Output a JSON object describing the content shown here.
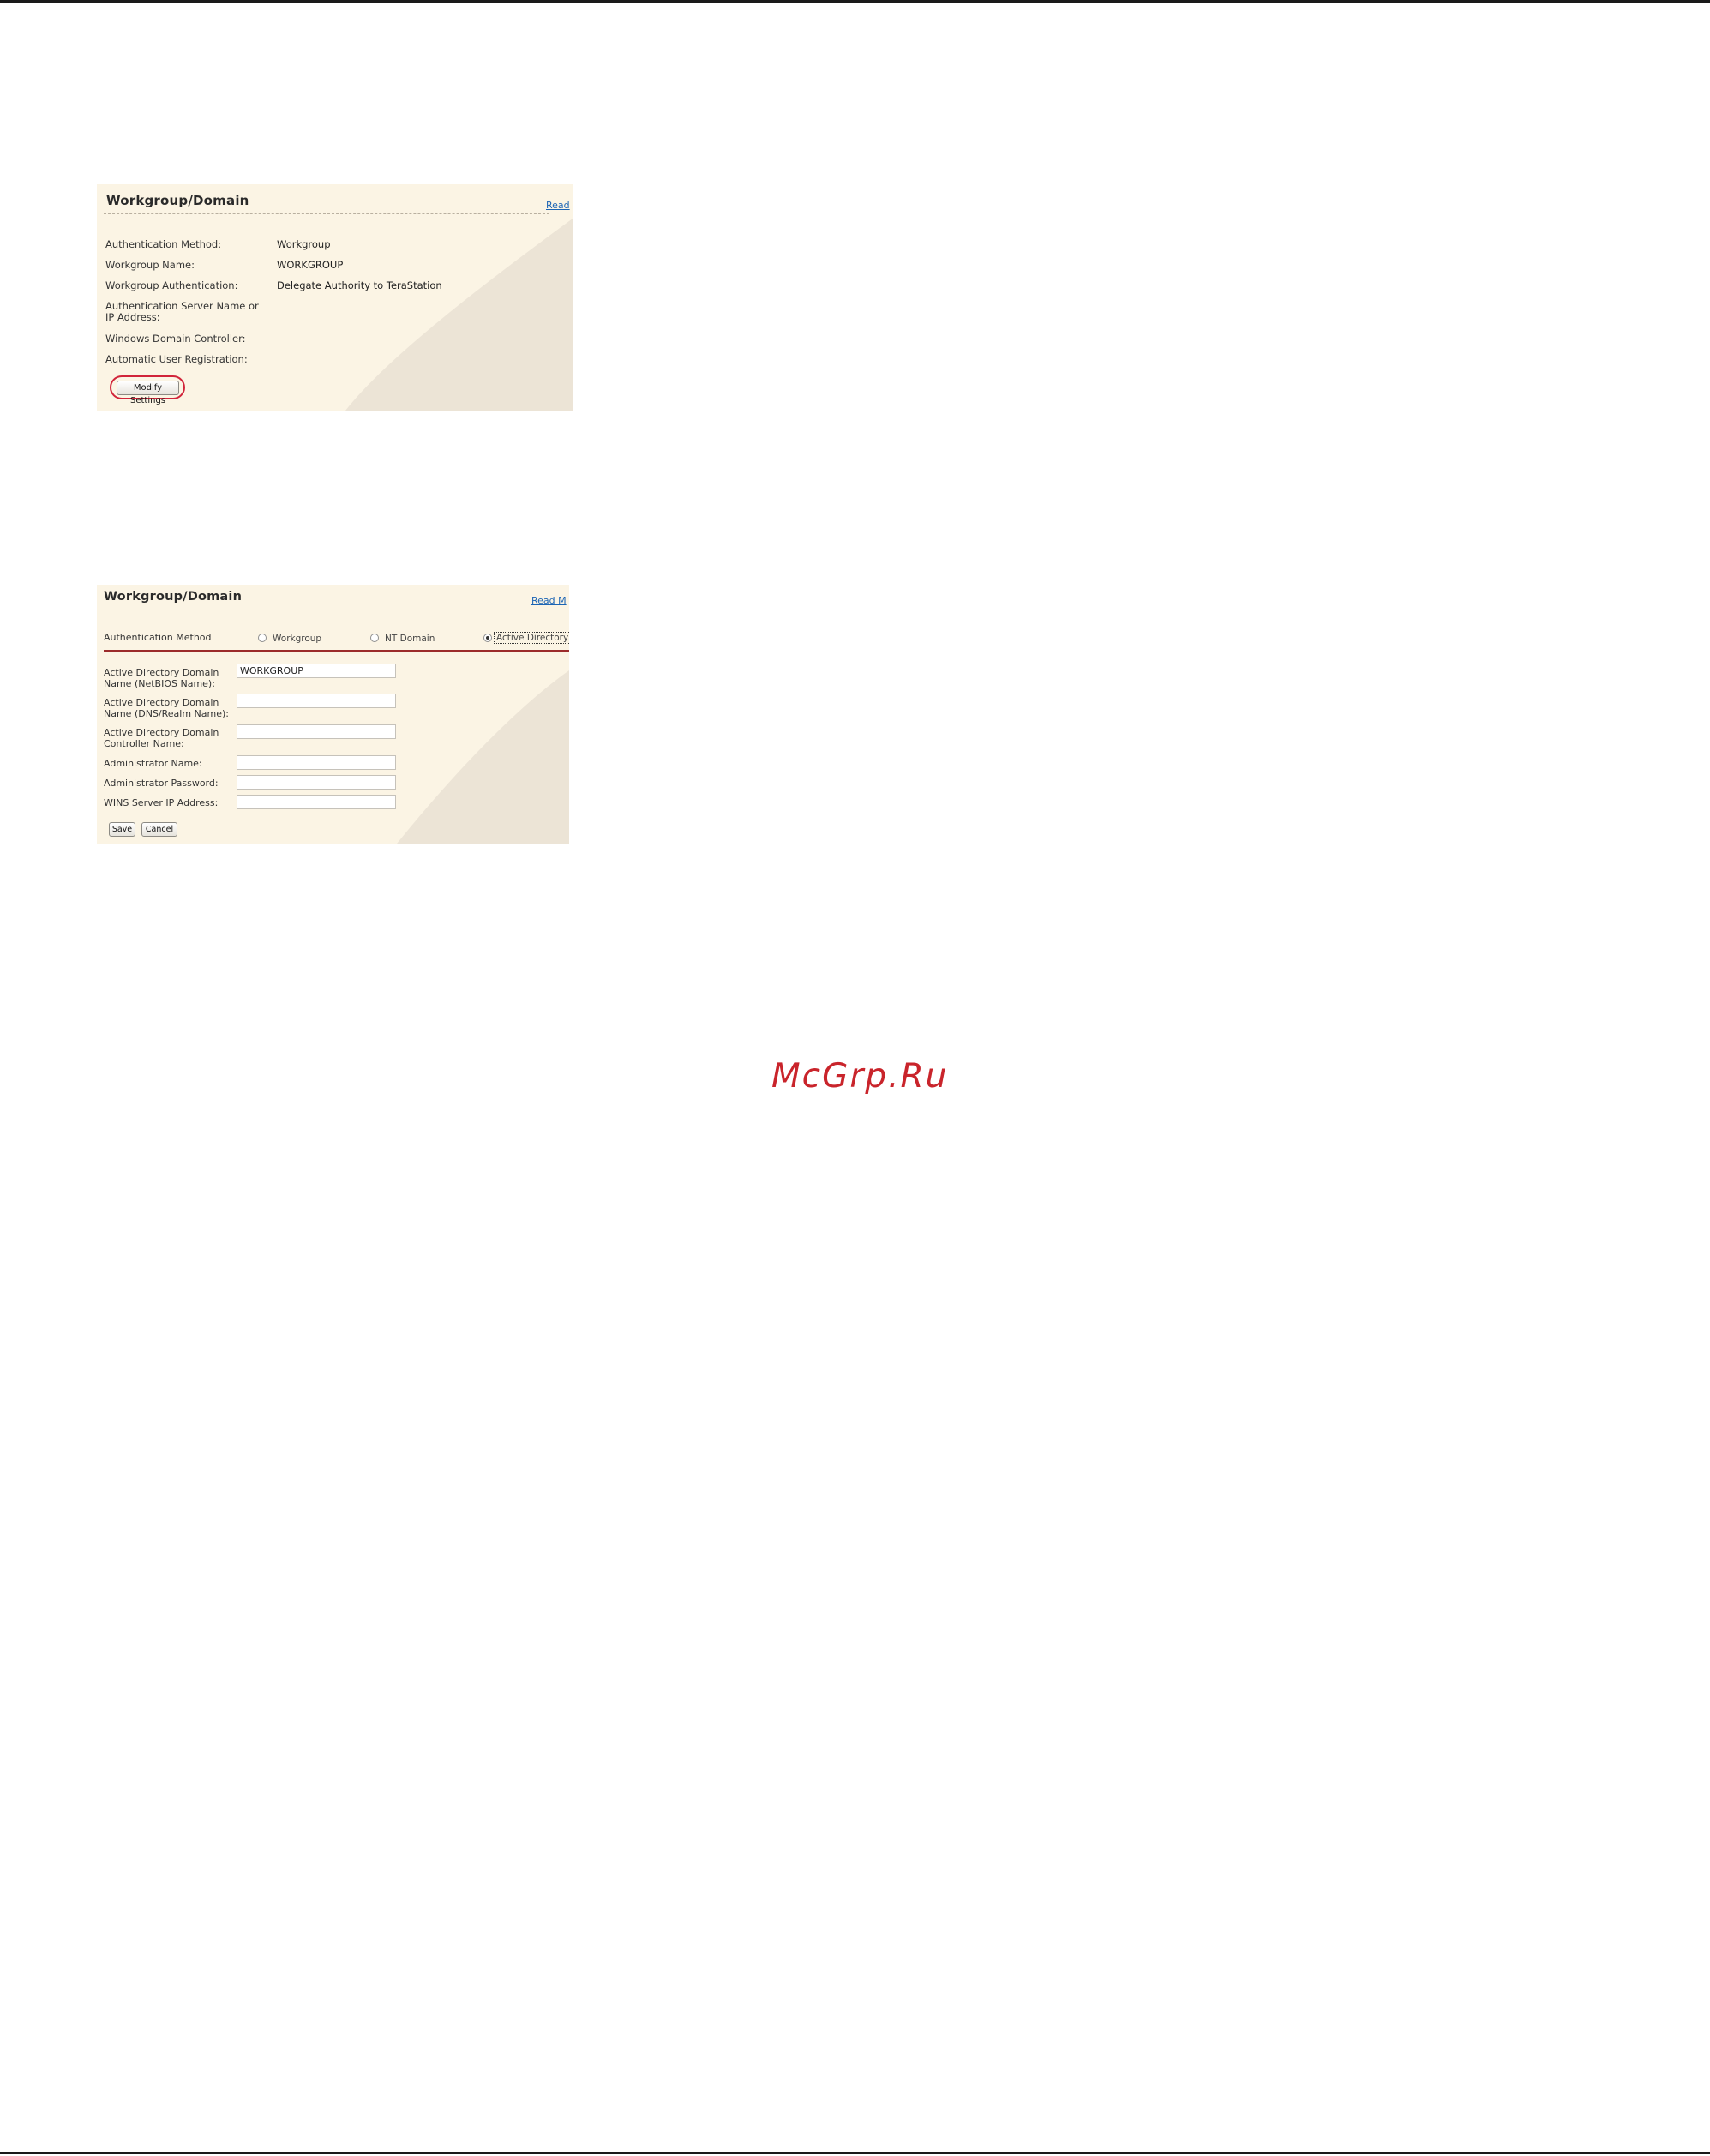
{
  "panel1": {
    "title": "Workgroup/Domain",
    "read_more": "Read",
    "rows": [
      {
        "label": "Authentication Method:",
        "value": "Workgroup"
      },
      {
        "label": "Workgroup Name:",
        "value": "WORKGROUP"
      },
      {
        "label": "Workgroup Authentication:",
        "value": "Delegate Authority to TeraStation"
      },
      {
        "label": "Authentication Server Name or IP Address:",
        "value": ""
      },
      {
        "label": "Windows Domain Controller:",
        "value": ""
      },
      {
        "label": "Automatic User Registration:",
        "value": ""
      }
    ],
    "modify_button": "Modify Settings"
  },
  "panel2": {
    "title": "Workgroup/Domain",
    "read_more": "Read M",
    "auth_method_label": "Authentication Method",
    "radios": [
      {
        "label": "Workgroup",
        "selected": false
      },
      {
        "label": "NT Domain",
        "selected": false
      },
      {
        "label": "Active Directory",
        "selected": true
      }
    ],
    "fields": [
      {
        "label": "Active Directory Domain Name (NetBIOS Name):",
        "value": "WORKGROUP"
      },
      {
        "label": "Active Directory Domain Name (DNS/Realm Name):",
        "value": ""
      },
      {
        "label": "Active Directory Domain Controller Name:",
        "value": ""
      },
      {
        "label": "Administrator Name:",
        "value": ""
      },
      {
        "label": "Administrator Password:",
        "value": ""
      },
      {
        "label": "WINS Server IP Address:",
        "value": ""
      }
    ],
    "save_button": "Save",
    "cancel_button": "Cancel"
  },
  "watermark": "McGrp.Ru",
  "colors": {
    "panel_bg": "#fbf4e4",
    "swoosh": "#ece4d6",
    "link": "#1b64b4",
    "highlight_ring": "#d1243a",
    "section_rule": "#9c2b2b",
    "watermark": "#c9242b"
  }
}
